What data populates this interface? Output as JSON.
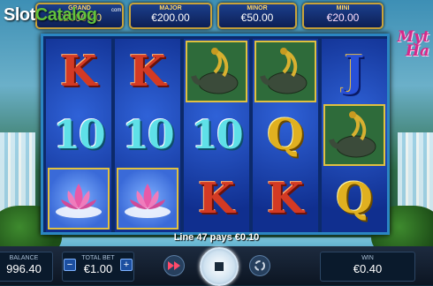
{
  "watermark": {
    "part1": "Slot",
    "part2": "Catalog",
    "suffix": "com"
  },
  "jackpots": [
    {
      "label": "GRAND",
      "value": "€2000.00"
    },
    {
      "label": "MAJOR",
      "value": "€200.00"
    },
    {
      "label": "MINOR",
      "value": "€50.00"
    },
    {
      "label": "MINI",
      "value": "€20.00"
    }
  ],
  "logo": {
    "line1": "Myt",
    "line2": "Ha",
    "bottom_text": "Myth"
  },
  "reels": [
    [
      "K",
      "10",
      "lotus"
    ],
    [
      "K",
      "10",
      "lotus"
    ],
    [
      "dragon-turtle",
      "10",
      "K"
    ],
    [
      "dragon-turtle",
      "Q",
      "K"
    ],
    [
      "J",
      "dragon-turtle",
      "Q"
    ]
  ],
  "win_message": "Line 47 pays €0.10",
  "bottom": {
    "balance_label": "BALANCE",
    "balance_value": "996.40",
    "totalbet_label": "TOTAL BET",
    "totalbet_value": "€1.00",
    "minus": "−",
    "plus": "+",
    "win_label": "WIN",
    "win_value": "€0.40"
  },
  "icons": {
    "turbo": "fast-forward-icon",
    "spin": "stop-icon",
    "autoplay": "autoplay-icon"
  }
}
